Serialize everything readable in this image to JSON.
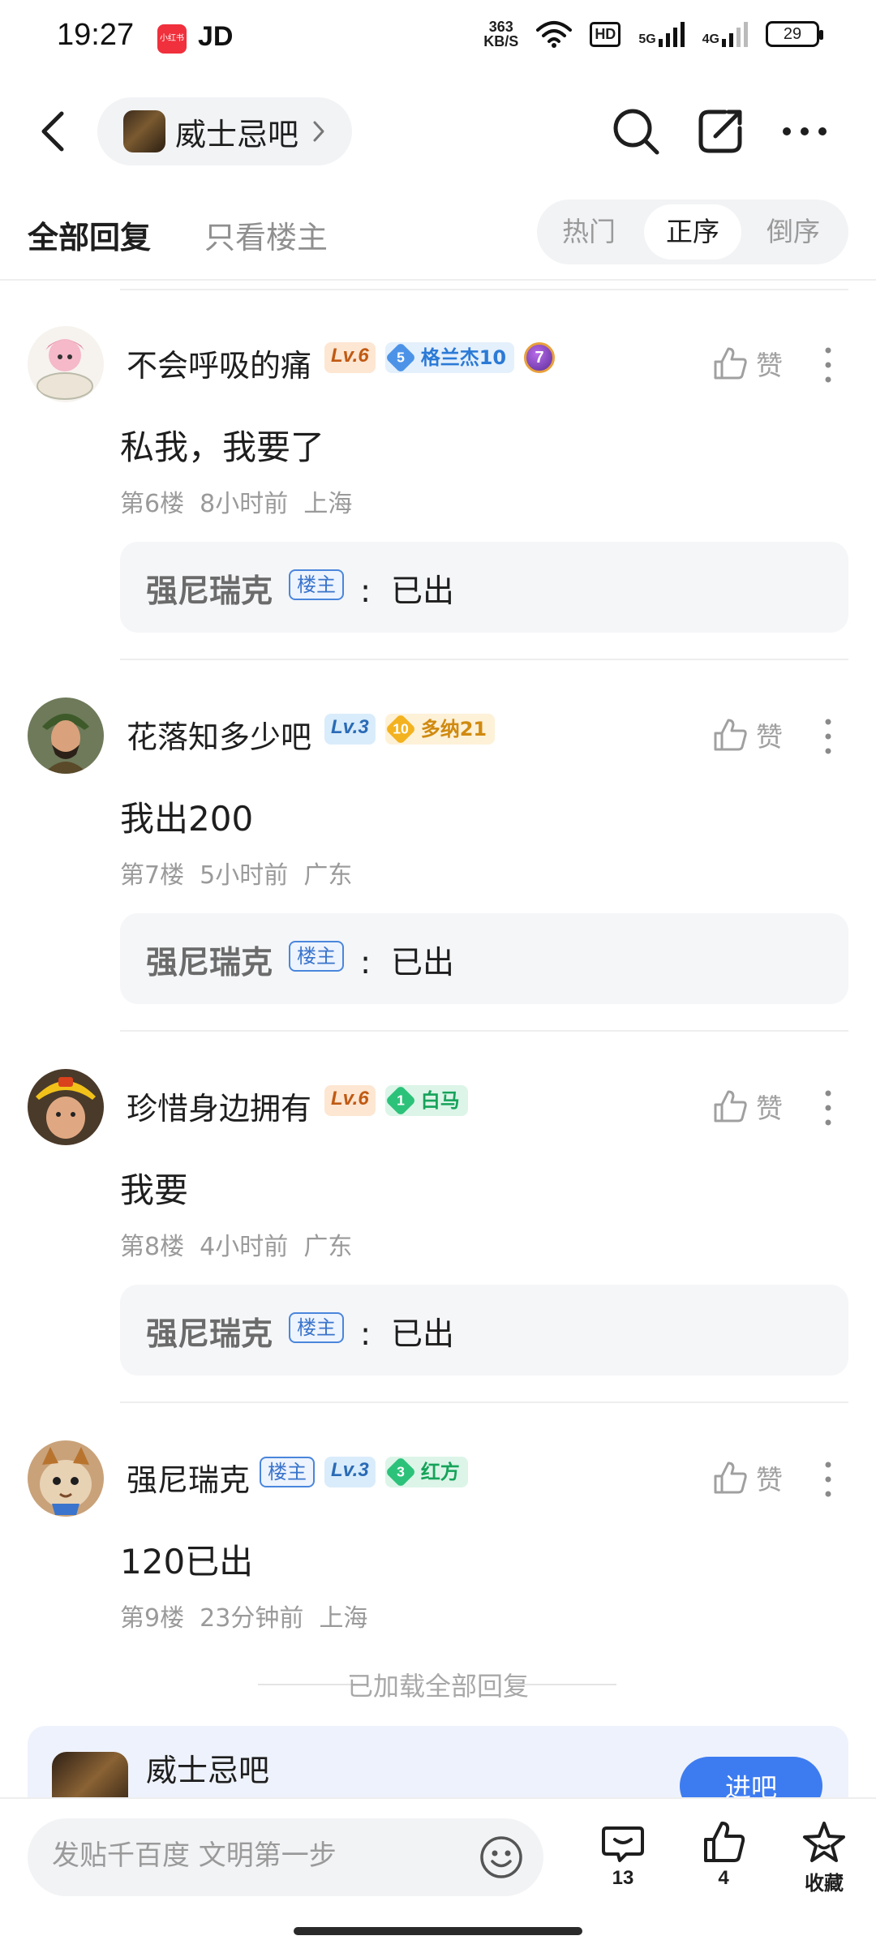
{
  "status_bar": {
    "time": "19:27",
    "app_badge": "小红书",
    "carrier_label": "JD",
    "net_speed_value": "363",
    "net_speed_unit": "KB/S",
    "hd_label": "HD",
    "sig1_label": "5G",
    "sig2_label": "4G",
    "battery": "29"
  },
  "nav": {
    "forum_name": "威士忌吧"
  },
  "tabs": {
    "all_replies": "全部回复",
    "op_only": "只看楼主",
    "sort_hot": "热门",
    "sort_asc": "正序",
    "sort_desc": "倒序",
    "active_sort": "正序"
  },
  "replies": [
    {
      "username": "不会呼吸的痛",
      "level": "Lv.6",
      "fan_level": "5",
      "fan_name": "格兰杰10",
      "medal": "7",
      "like_label": "赞",
      "content": "私我，我要了",
      "floor": "第6楼",
      "time_ago": "8小时前",
      "location": "上海",
      "sub_reply": {
        "user": "强尼瑞克",
        "tag": "楼主",
        "colon": ":",
        "text": "已出"
      }
    },
    {
      "username": "花落知多少吧",
      "level": "Lv.3",
      "fan_level": "10",
      "fan_name": "多纳21",
      "like_label": "赞",
      "content": "我出200",
      "floor": "第7楼",
      "time_ago": "5小时前",
      "location": "广东",
      "sub_reply": {
        "user": "强尼瑞克",
        "tag": "楼主",
        "colon": ":",
        "text": "已出"
      }
    },
    {
      "username": "珍惜身边拥有",
      "level": "Lv.6",
      "fan_level": "1",
      "fan_name": "白马",
      "like_label": "赞",
      "content": "我要",
      "floor": "第8楼",
      "time_ago": "4小时前",
      "location": "广东",
      "sub_reply": {
        "user": "强尼瑞克",
        "tag": "楼主",
        "colon": ":",
        "text": "已出"
      }
    },
    {
      "username": "强尼瑞克",
      "host_tag": "楼主",
      "level": "Lv.3",
      "fan_level": "3",
      "fan_name": "红方",
      "like_label": "赞",
      "content": "120已出",
      "floor": "第9楼",
      "time_ago": "23分钟前",
      "location": "上海"
    }
  ],
  "end_marker": "已加载全部回复",
  "forum_card": {
    "name": "威士忌吧",
    "join_label": "进吧"
  },
  "bottom_bar": {
    "compose_placeholder": "发贴千百度 文明第一步",
    "comment_count": "13",
    "like_count": "4",
    "favorite_label": "收藏"
  },
  "colors": {
    "accent_blue": "#3d7cf0",
    "level_orange": "#c05a14",
    "level_blue": "#2a6bb6"
  }
}
